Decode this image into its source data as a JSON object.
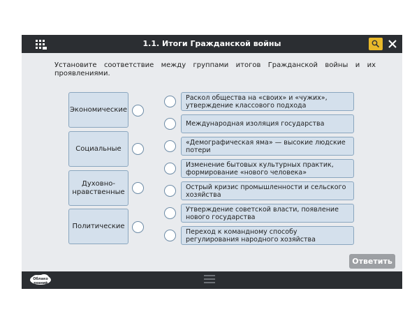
{
  "window": {
    "title": "1.1. Итоги Гражданской войны"
  },
  "instruction": "Установите соответствие между группами итогов Гражданской войны и их проявлениями.",
  "categories": [
    {
      "label": "Экономические"
    },
    {
      "label": "Социальные"
    },
    {
      "label": "Духовно-нравственные"
    },
    {
      "label": "Политические"
    }
  ],
  "outcomes": [
    {
      "label": "Раскол общества на «своих» и «чужих», утверждение классового подхода"
    },
    {
      "label": "Международная изоляция государства"
    },
    {
      "label": "«Демографическая яма» — высокие людские потери"
    },
    {
      "label": "Изменение бытовых культурных практик, формирование «нового человека»"
    },
    {
      "label": "Острый кризис промышленности и сельского хозяйства"
    },
    {
      "label": "Утверждение советской власти, появление нового государства"
    },
    {
      "label": "Переход к командному способу регулирования народного хозяйства"
    }
  ],
  "footer": {
    "answer_label": "Ответить",
    "logo_text": "Облако знаний"
  },
  "icons": {
    "menu": "grid-icon",
    "search": "search-icon",
    "close": "close-icon",
    "nav": "hamburger-icon",
    "logo": "logo-icon"
  },
  "colors": {
    "accent": "#e9b92a",
    "item_fill": "#d4e0ec",
    "item_border": "#8aa6bf",
    "bar": "#2b2e32",
    "button": "#9c9fa3"
  }
}
